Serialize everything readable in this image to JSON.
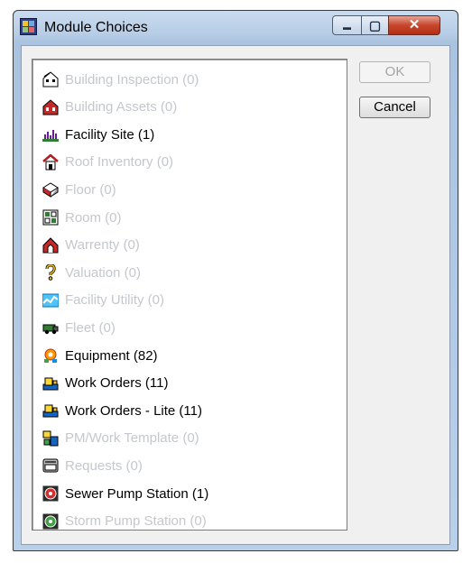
{
  "window": {
    "title": "Module Choices",
    "minimize_glyph": "▬",
    "maximize_glyph": "▢",
    "close_glyph": "✕"
  },
  "buttons": {
    "ok_label": "OK",
    "ok_enabled": false,
    "cancel_label": "Cancel"
  },
  "modules": [
    {
      "label": "Building Inspection (0)",
      "icon": "building-inspection-icon",
      "enabled": false
    },
    {
      "label": "Building Assets (0)",
      "icon": "building-assets-icon",
      "enabled": false
    },
    {
      "label": "Facility Site (1)",
      "icon": "facility-site-icon",
      "enabled": true
    },
    {
      "label": "Roof Inventory (0)",
      "icon": "roof-inventory-icon",
      "enabled": false
    },
    {
      "label": "Floor (0)",
      "icon": "floor-icon",
      "enabled": false
    },
    {
      "label": "Room (0)",
      "icon": "room-icon",
      "enabled": false
    },
    {
      "label": "Warrenty (0)",
      "icon": "warranty-icon",
      "enabled": false
    },
    {
      "label": "Valuation (0)",
      "icon": "valuation-icon",
      "enabled": false
    },
    {
      "label": "Facility Utility (0)",
      "icon": "facility-utility-icon",
      "enabled": false
    },
    {
      "label": "Fleet (0)",
      "icon": "fleet-icon",
      "enabled": false
    },
    {
      "label": "Equipment (82)",
      "icon": "equipment-icon",
      "enabled": true
    },
    {
      "label": "Work Orders (11)",
      "icon": "work-orders-icon",
      "enabled": true
    },
    {
      "label": "Work Orders - Lite (11)",
      "icon": "work-orders-lite-icon",
      "enabled": true
    },
    {
      "label": "PM/Work Template (0)",
      "icon": "pm-work-template-icon",
      "enabled": false
    },
    {
      "label": "Requests (0)",
      "icon": "requests-icon",
      "enabled": false
    },
    {
      "label": "Sewer Pump Station (1)",
      "icon": "sewer-pump-station-icon",
      "enabled": true
    },
    {
      "label": "Storm Pump Station (0)",
      "icon": "storm-pump-station-icon",
      "enabled": false
    }
  ]
}
